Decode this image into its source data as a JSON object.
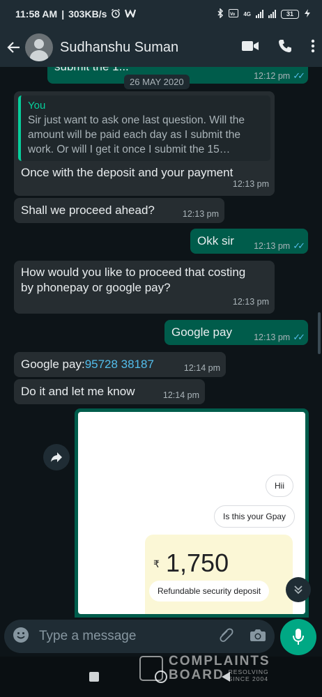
{
  "status_bar": {
    "time": "11:58 AM",
    "speed": "303KB/s",
    "network": "4G",
    "battery": "31"
  },
  "header": {
    "contact_name": "Sudhanshu Suman"
  },
  "date_chip": "26 MAY 2020",
  "messages": [
    {
      "direction": "out",
      "text": "submit the 1...",
      "time": "12:12 pm"
    },
    {
      "direction": "in",
      "quote_author": "You",
      "quote_text": "Sir just want to ask one last question. Will the amount will be paid each day as I submit the work. Or will I get it once I submit the 15…",
      "text": "Once with the deposit and your payment",
      "time": "12:13 pm"
    },
    {
      "direction": "in",
      "text": "Shall we proceed ahead?",
      "time": "12:13 pm"
    },
    {
      "direction": "out",
      "text": "Okk sir",
      "time": "12:13 pm"
    },
    {
      "direction": "in",
      "text": "How would you like to proceed that costing by phonepay or google pay?",
      "time": "12:13 pm"
    },
    {
      "direction": "out",
      "text": "Google pay",
      "time": "12:13 pm"
    },
    {
      "direction": "in",
      "text_prefix": "Google pay:",
      "link": "95728 38187",
      "time": "12:14 pm"
    },
    {
      "direction": "in",
      "text": "Do it and let me know",
      "time": "12:14 pm"
    }
  ],
  "image_message": {
    "chip_1": "Hii",
    "chip_2": "Is this your Gpay",
    "currency": "₹",
    "amount": "1,750",
    "note": "Refundable security deposit"
  },
  "composer": {
    "placeholder": "Type a message"
  },
  "watermark": {
    "line1": "COMPLAINTS",
    "line2": "BOARD",
    "tag1": "RESOLVING",
    "tag2": "SINCE 2004"
  },
  "colors": {
    "header_bg": "#1f2c34",
    "chat_bg": "#0d1418",
    "incoming_bubble": "#262d31",
    "outgoing_bubble": "#005c4b",
    "accent": "#00a884",
    "read_ticks": "#53bdeb"
  }
}
